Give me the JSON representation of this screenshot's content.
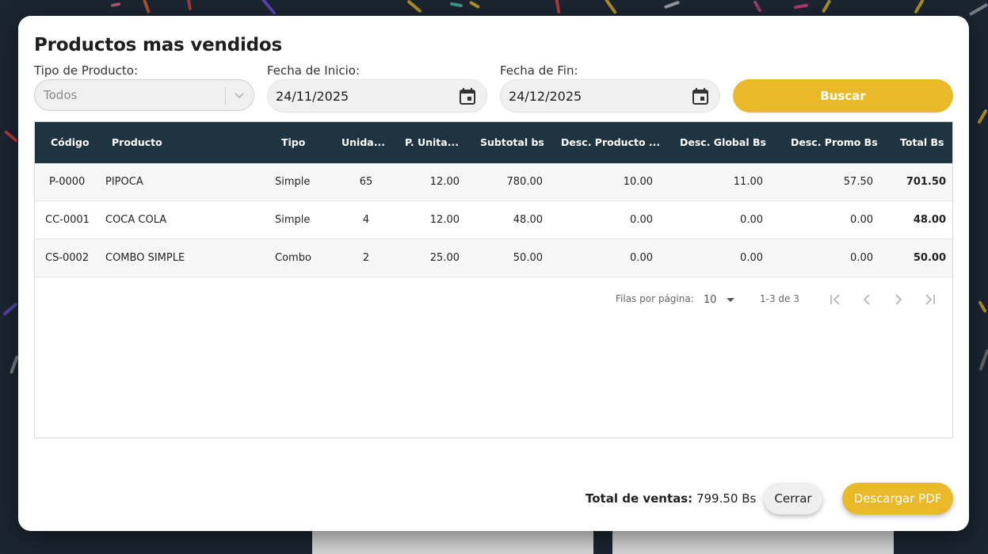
{
  "modal": {
    "title": "Productos mas vendidos"
  },
  "filters": {
    "tipo_label": "Tipo de Producto:",
    "tipo_value": "Todos",
    "inicio_label": "Fecha de Inicio:",
    "inicio_value": "24/11/2025",
    "fin_label": "Fecha de Fin:",
    "fin_value": "24/12/2025",
    "buscar_label": "Buscar"
  },
  "table": {
    "columns": [
      "Código",
      "Producto",
      "Tipo",
      "Unida...",
      "P. Unita...",
      "Subtotal bs",
      "Desc. Producto ...",
      "Desc. Global Bs",
      "Desc. Promo Bs",
      "Total Bs"
    ],
    "rows": [
      [
        "P-0000",
        "PIPOCA",
        "Simple",
        "65",
        "12.00",
        "780.00",
        "10.00",
        "11.00",
        "57.50",
        "701.50"
      ],
      [
        "CC-0001",
        "COCA COLA",
        "Simple",
        "4",
        "12.00",
        "48.00",
        "0.00",
        "0.00",
        "0.00",
        "48.00"
      ],
      [
        "CS-0002",
        "COMBO SIMPLE",
        "Combo",
        "2",
        "25.00",
        "50.00",
        "0.00",
        "0.00",
        "0.00",
        "50.00"
      ]
    ]
  },
  "pagination": {
    "rows_per_page_label": "Filas por página:",
    "rows_per_page_value": "10",
    "range_text": "1-3 de 3"
  },
  "footer": {
    "total_label": "Total de ventas:",
    "total_value": "799.50 Bs",
    "cerrar_label": "Cerrar",
    "pdf_label": "Descargar PDF"
  },
  "colors": {
    "accent": "#e9b92a",
    "header_bg": "#1f3441",
    "backdrop": "#1b2530"
  },
  "icons": [
    "chevron-down-icon",
    "calendar-icon",
    "first-page-icon",
    "prev-page-icon",
    "next-page-icon",
    "last-page-icon",
    "dropdown-caret-icon"
  ]
}
